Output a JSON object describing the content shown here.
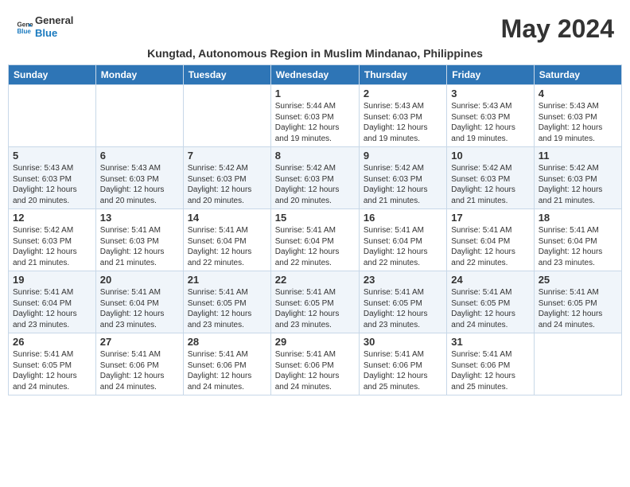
{
  "header": {
    "logo_line1": "General",
    "logo_line2": "Blue",
    "month_year": "May 2024",
    "subtitle": "Kungtad, Autonomous Region in Muslim Mindanao, Philippines"
  },
  "weekdays": [
    "Sunday",
    "Monday",
    "Tuesday",
    "Wednesday",
    "Thursday",
    "Friday",
    "Saturday"
  ],
  "weeks": [
    [
      {
        "day": "",
        "info": ""
      },
      {
        "day": "",
        "info": ""
      },
      {
        "day": "",
        "info": ""
      },
      {
        "day": "1",
        "info": "Sunrise: 5:44 AM\nSunset: 6:03 PM\nDaylight: 12 hours\nand 19 minutes."
      },
      {
        "day": "2",
        "info": "Sunrise: 5:43 AM\nSunset: 6:03 PM\nDaylight: 12 hours\nand 19 minutes."
      },
      {
        "day": "3",
        "info": "Sunrise: 5:43 AM\nSunset: 6:03 PM\nDaylight: 12 hours\nand 19 minutes."
      },
      {
        "day": "4",
        "info": "Sunrise: 5:43 AM\nSunset: 6:03 PM\nDaylight: 12 hours\nand 19 minutes."
      }
    ],
    [
      {
        "day": "5",
        "info": "Sunrise: 5:43 AM\nSunset: 6:03 PM\nDaylight: 12 hours\nand 20 minutes."
      },
      {
        "day": "6",
        "info": "Sunrise: 5:43 AM\nSunset: 6:03 PM\nDaylight: 12 hours\nand 20 minutes."
      },
      {
        "day": "7",
        "info": "Sunrise: 5:42 AM\nSunset: 6:03 PM\nDaylight: 12 hours\nand 20 minutes."
      },
      {
        "day": "8",
        "info": "Sunrise: 5:42 AM\nSunset: 6:03 PM\nDaylight: 12 hours\nand 20 minutes."
      },
      {
        "day": "9",
        "info": "Sunrise: 5:42 AM\nSunset: 6:03 PM\nDaylight: 12 hours\nand 21 minutes."
      },
      {
        "day": "10",
        "info": "Sunrise: 5:42 AM\nSunset: 6:03 PM\nDaylight: 12 hours\nand 21 minutes."
      },
      {
        "day": "11",
        "info": "Sunrise: 5:42 AM\nSunset: 6:03 PM\nDaylight: 12 hours\nand 21 minutes."
      }
    ],
    [
      {
        "day": "12",
        "info": "Sunrise: 5:42 AM\nSunset: 6:03 PM\nDaylight: 12 hours\nand 21 minutes."
      },
      {
        "day": "13",
        "info": "Sunrise: 5:41 AM\nSunset: 6:03 PM\nDaylight: 12 hours\nand 21 minutes."
      },
      {
        "day": "14",
        "info": "Sunrise: 5:41 AM\nSunset: 6:04 PM\nDaylight: 12 hours\nand 22 minutes."
      },
      {
        "day": "15",
        "info": "Sunrise: 5:41 AM\nSunset: 6:04 PM\nDaylight: 12 hours\nand 22 minutes."
      },
      {
        "day": "16",
        "info": "Sunrise: 5:41 AM\nSunset: 6:04 PM\nDaylight: 12 hours\nand 22 minutes."
      },
      {
        "day": "17",
        "info": "Sunrise: 5:41 AM\nSunset: 6:04 PM\nDaylight: 12 hours\nand 22 minutes."
      },
      {
        "day": "18",
        "info": "Sunrise: 5:41 AM\nSunset: 6:04 PM\nDaylight: 12 hours\nand 23 minutes."
      }
    ],
    [
      {
        "day": "19",
        "info": "Sunrise: 5:41 AM\nSunset: 6:04 PM\nDaylight: 12 hours\nand 23 minutes."
      },
      {
        "day": "20",
        "info": "Sunrise: 5:41 AM\nSunset: 6:04 PM\nDaylight: 12 hours\nand 23 minutes."
      },
      {
        "day": "21",
        "info": "Sunrise: 5:41 AM\nSunset: 6:05 PM\nDaylight: 12 hours\nand 23 minutes."
      },
      {
        "day": "22",
        "info": "Sunrise: 5:41 AM\nSunset: 6:05 PM\nDaylight: 12 hours\nand 23 minutes."
      },
      {
        "day": "23",
        "info": "Sunrise: 5:41 AM\nSunset: 6:05 PM\nDaylight: 12 hours\nand 23 minutes."
      },
      {
        "day": "24",
        "info": "Sunrise: 5:41 AM\nSunset: 6:05 PM\nDaylight: 12 hours\nand 24 minutes."
      },
      {
        "day": "25",
        "info": "Sunrise: 5:41 AM\nSunset: 6:05 PM\nDaylight: 12 hours\nand 24 minutes."
      }
    ],
    [
      {
        "day": "26",
        "info": "Sunrise: 5:41 AM\nSunset: 6:05 PM\nDaylight: 12 hours\nand 24 minutes."
      },
      {
        "day": "27",
        "info": "Sunrise: 5:41 AM\nSunset: 6:06 PM\nDaylight: 12 hours\nand 24 minutes."
      },
      {
        "day": "28",
        "info": "Sunrise: 5:41 AM\nSunset: 6:06 PM\nDaylight: 12 hours\nand 24 minutes."
      },
      {
        "day": "29",
        "info": "Sunrise: 5:41 AM\nSunset: 6:06 PM\nDaylight: 12 hours\nand 24 minutes."
      },
      {
        "day": "30",
        "info": "Sunrise: 5:41 AM\nSunset: 6:06 PM\nDaylight: 12 hours\nand 25 minutes."
      },
      {
        "day": "31",
        "info": "Sunrise: 5:41 AM\nSunset: 6:06 PM\nDaylight: 12 hours\nand 25 minutes."
      },
      {
        "day": "",
        "info": ""
      }
    ]
  ]
}
